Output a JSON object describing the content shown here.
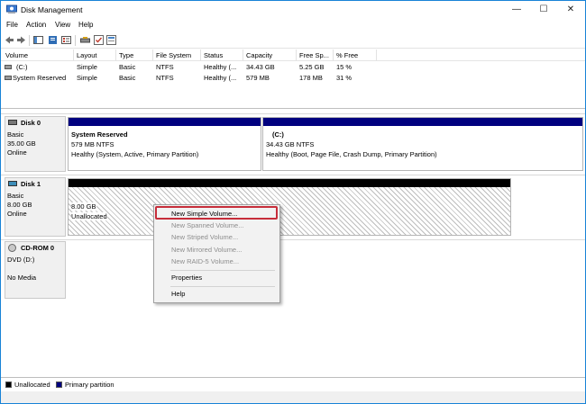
{
  "window": {
    "title": "Disk Management"
  },
  "menubar": {
    "items": [
      "File",
      "Action",
      "View",
      "Help"
    ]
  },
  "volumes": {
    "columns": [
      "Volume",
      "Layout",
      "Type",
      "File System",
      "Status",
      "Capacity",
      "Free Sp...",
      "% Free"
    ],
    "rows": [
      [
        "(C:)",
        "Simple",
        "Basic",
        "NTFS",
        "Healthy (...",
        "34.43 GB",
        "5.25 GB",
        "15 %"
      ],
      [
        "System Reserved",
        "Simple",
        "Basic",
        "NTFS",
        "Healthy (...",
        "579 MB",
        "178 MB",
        "31 %"
      ]
    ]
  },
  "disks": [
    {
      "name": "Disk 0",
      "type": "Basic",
      "size": "35.00 GB",
      "state": "Online",
      "partitions": [
        {
          "title": "System Reserved",
          "info": "579 MB NTFS",
          "status": "Healthy (System, Active, Primary Partition)"
        },
        {
          "title": "(C:)",
          "info": "34.43 GB NTFS",
          "status": "Healthy (Boot, Page File, Crash Dump, Primary Partition)"
        }
      ]
    },
    {
      "name": "Disk 1",
      "type": "Basic",
      "size": "8.00 GB",
      "state": "Online",
      "partitions": [
        {
          "title": "",
          "info": "8.00 GB",
          "status": "Unallocated"
        }
      ]
    },
    {
      "name": "CD-ROM 0",
      "type": "DVD (D:)",
      "size": "",
      "state": "No Media",
      "partitions": []
    }
  ],
  "context_menu": {
    "items": [
      {
        "label": "New Simple Volume...",
        "enabled": true
      },
      {
        "label": "New Spanned Volume...",
        "enabled": false
      },
      {
        "label": "New Striped Volume...",
        "enabled": false
      },
      {
        "label": "New Mirrored Volume...",
        "enabled": false
      },
      {
        "label": "New RAID-5 Volume...",
        "enabled": false
      },
      {
        "label": "Properties",
        "enabled": true
      },
      {
        "label": "Help",
        "enabled": true
      }
    ]
  },
  "legend": [
    {
      "label": "Unallocated",
      "color": "#000000"
    },
    {
      "label": "Primary partition",
      "color": "#00007f"
    }
  ],
  "colors": {
    "primary_partition": "#00007f",
    "unallocated": "#000000",
    "highlight": "#c62d3a",
    "window_border": "#1883d7"
  },
  "window_controls": {
    "minimize": "—",
    "maximize": "☐",
    "close": "✕"
  }
}
